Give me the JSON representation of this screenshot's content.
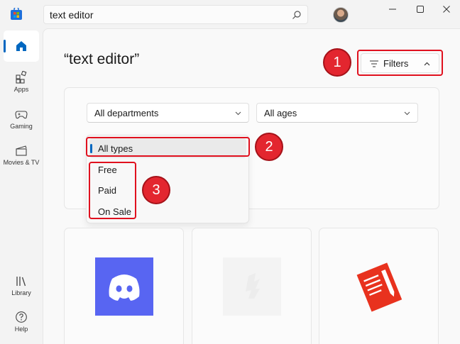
{
  "search": {
    "value": "text editor"
  },
  "sidebar": {
    "items": [
      {
        "label": ""
      },
      {
        "label": "Apps"
      },
      {
        "label": "Gaming"
      },
      {
        "label": "Movies & TV"
      },
      {
        "label": "Library"
      },
      {
        "label": "Help"
      }
    ]
  },
  "main": {
    "title": "“text editor”",
    "filters_label": "Filters",
    "departments": {
      "selected": "All departments"
    },
    "ages": {
      "selected": "All ages"
    },
    "type_menu": {
      "items": [
        "All types",
        "Free",
        "Paid",
        "On Sale"
      ],
      "selected_index": 0
    }
  },
  "annotations": [
    "1",
    "2",
    "3"
  ],
  "colors": {
    "accent": "#0067c0",
    "callout": "#e0101e",
    "discord": "#5865f2",
    "notepad": "#e8321e"
  },
  "icons": [
    "store-logo-icon",
    "search-icon",
    "minimize-icon",
    "maximize-icon",
    "close-icon",
    "home-icon",
    "apps-icon",
    "gaming-icon",
    "movies-icon",
    "library-icon",
    "help-icon",
    "filter-icon",
    "chevron-up-icon",
    "chevron-down-icon"
  ]
}
